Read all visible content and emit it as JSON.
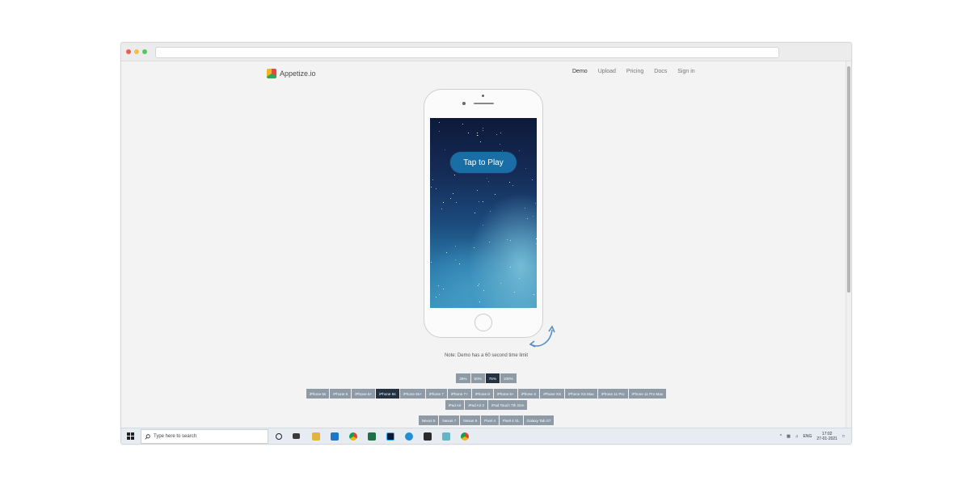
{
  "browser": {
    "colors": {
      "close": "#ee5c54",
      "minimize": "#f5bd4f",
      "maximize": "#56c658"
    }
  },
  "site": {
    "brand": "Appetize.io",
    "nav": [
      {
        "label": "Demo",
        "active": true
      },
      {
        "label": "Upload",
        "active": false
      },
      {
        "label": "Pricing",
        "active": false
      },
      {
        "label": "Docs",
        "active": false
      },
      {
        "label": "Sign in",
        "active": false
      }
    ]
  },
  "phone": {
    "play_label": "Tap to Play"
  },
  "note": "Note: Demo has a 60 second time limit",
  "zoom": {
    "options": [
      "25%",
      "50%",
      "75%",
      "100%"
    ],
    "selected": "75%"
  },
  "devices": {
    "row1": [
      "iPhone 5s",
      "iPhone 6",
      "iPhone 6+",
      "iPhone 6s",
      "iPhone 6s+",
      "iPhone 7",
      "iPhone 7+",
      "iPhone 8",
      "iPhone 8+",
      "iPhone X",
      "iPhone XS",
      "iPhone XS Max",
      "iPhone 11 Pro",
      "iPhone 11 Pro Max"
    ],
    "row2": [
      "iPad Air",
      "iPad Air 2",
      "iPad Touch 7th Gen"
    ],
    "row3": [
      "Nexus 5",
      "Nexus 7",
      "Nexus 9",
      "Pixel 4",
      "Pixel 4 XL",
      "Galaxy Tab S7"
    ],
    "selected": "iPhone 6s"
  },
  "taskbar": {
    "search_placeholder": "Type here to search",
    "language": "ENG",
    "time": "17:02",
    "date": "27-01-2021"
  }
}
